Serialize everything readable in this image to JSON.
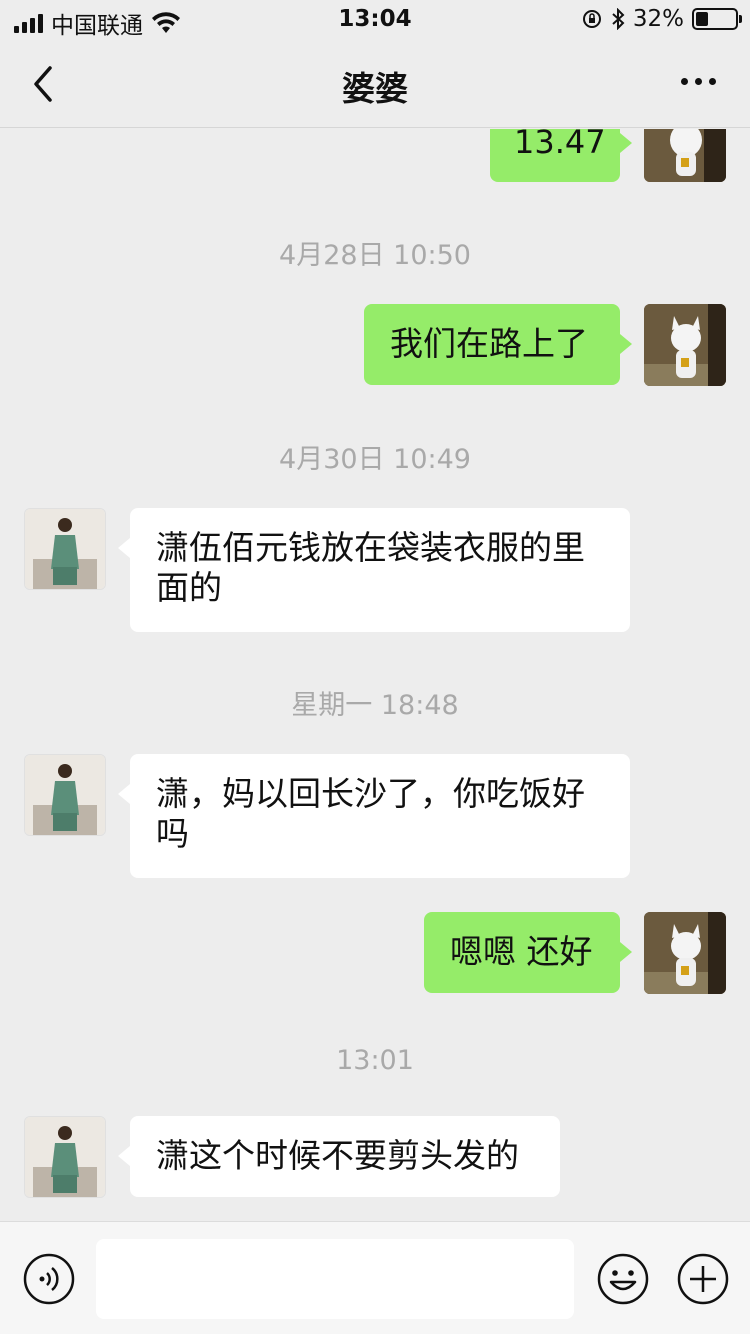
{
  "status_bar": {
    "carrier": "中国联通",
    "time": "13:04",
    "battery_percent": "32%",
    "battery_level": 0.32
  },
  "nav": {
    "title": "婆婆"
  },
  "messages": [
    {
      "type": "outgoing",
      "text": "13.47"
    },
    {
      "type": "timestamp",
      "text": "4月28日 10:50"
    },
    {
      "type": "outgoing",
      "text": "我们在路上了"
    },
    {
      "type": "timestamp",
      "text": "4月30日 10:49"
    },
    {
      "type": "incoming",
      "text": "潇伍佰元钱放在袋装衣服的里面的"
    },
    {
      "type": "timestamp",
      "text": "星期一 18:48"
    },
    {
      "type": "incoming",
      "text": "潇，妈以回长沙了，你吃饭好吗"
    },
    {
      "type": "outgoing",
      "text": "嗯嗯 还好"
    },
    {
      "type": "timestamp",
      "text": "13:01"
    },
    {
      "type": "incoming",
      "text": "潇这个时候不要剪头发的"
    }
  ],
  "input_bar": {
    "value": "",
    "icons": [
      "voice-icon",
      "emoji-icon",
      "plus-icon"
    ]
  },
  "colors": {
    "outgoing_bubble": "#95ec69",
    "incoming_bubble": "#ffffff",
    "background": "#ededed"
  }
}
